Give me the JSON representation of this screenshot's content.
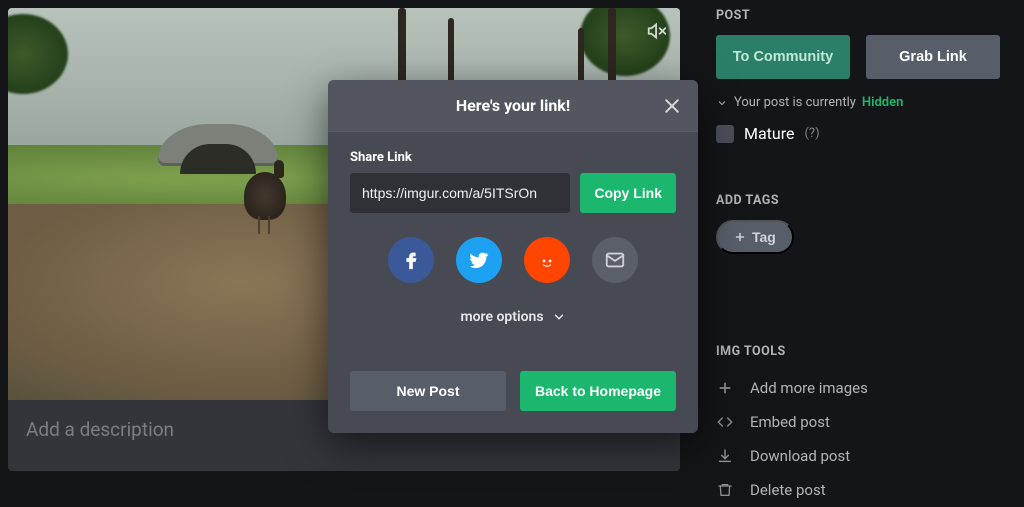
{
  "main": {
    "description_placeholder": "Add a description"
  },
  "modal": {
    "title": "Here's your link!",
    "share_label": "Share Link",
    "url": "https://imgur.com/a/5ITSrOn",
    "copy_label": "Copy Link",
    "more_options": "more options",
    "new_post": "New Post",
    "back_home": "Back to Homepage"
  },
  "sidebar": {
    "post_heading": "POST",
    "to_community": "To Community",
    "grab_link": "Grab Link",
    "status_prefix": "Your post is currently",
    "status_value": "Hidden",
    "mature_label": "Mature",
    "mature_help": "(?)",
    "tags_heading": "ADD TAGS",
    "tag_button": "Tag",
    "tools_heading": "IMG TOOLS",
    "tools": [
      "Add more images",
      "Embed post",
      "Download post",
      "Delete post"
    ]
  }
}
